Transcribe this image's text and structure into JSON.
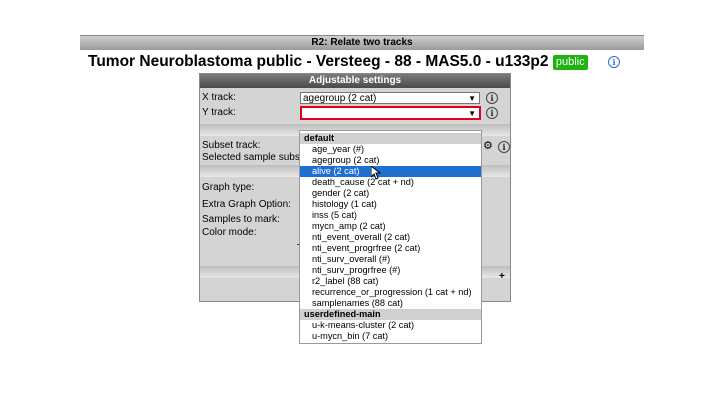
{
  "header": {
    "bar_title": "R2: Relate two tracks",
    "page_title": "Tumor Neuroblastoma public - Versteeg - 88 - MAS5.0 - u133p2",
    "badge": "public",
    "info_glyph": "i"
  },
  "panel": {
    "title": "Adjustable settings",
    "x_track_label": "X track:",
    "x_track_value": "agegroup (2 cat)",
    "y_track_label": "Y track:",
    "y_track_value": "",
    "subset_track_label": "Subset track:",
    "selected_sample_subset_label": "Selected sample subset:",
    "graph_type_label": "Graph type:",
    "extra_graph_option_label": "Extra Graph Option:",
    "samples_to_mark_label": "Samples to mark:",
    "color_mode_label": "Color mode:",
    "partial_text": "T",
    "plus_label": "+"
  },
  "dropdown": {
    "groups": [
      {
        "label": "default",
        "options": [
          "age_year (#)",
          "agegroup (2 cat)",
          "alive (2 cat)",
          "death_cause (2 cat + nd)",
          "gender (2 cat)",
          "histology (1 cat)",
          "inss (5 cat)",
          "mycn_amp (2 cat)",
          "nti_event_overall (2 cat)",
          "nti_event_progrfree (2 cat)",
          "nti_surv_overall (#)",
          "nti_surv_progrfree (#)",
          "r2_label (88 cat)",
          "recurrence_or_progression (1 cat + nd)",
          "samplenames (88 cat)"
        ]
      },
      {
        "label": "userdefined-main",
        "options": [
          "u-k-means-cluster (2 cat)",
          "u-mycn_bin (7 cat)"
        ]
      }
    ],
    "highlighted": "alive (2 cat)"
  },
  "colors": {
    "badge": "#1fb312",
    "highlight": "#1e6fd0",
    "y_track_border": "#e0001b"
  }
}
